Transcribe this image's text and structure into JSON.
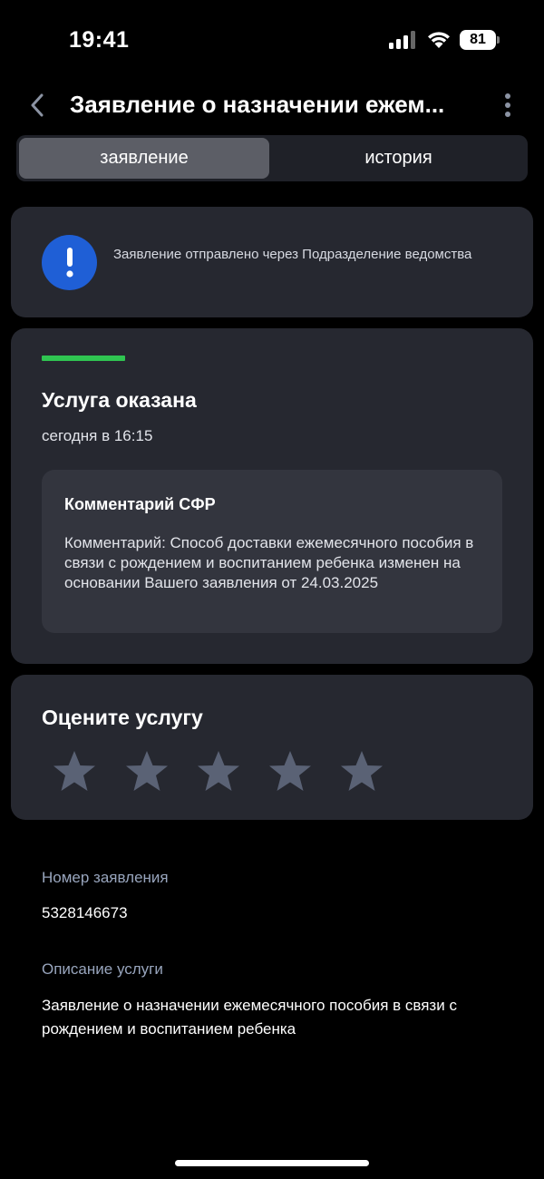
{
  "status_bar": {
    "time": "19:41",
    "battery_level": "81",
    "icons": [
      "signal-icon",
      "wifi-icon",
      "battery-icon"
    ]
  },
  "header": {
    "title": "Заявление о назначении ежем...",
    "back_icon": "chevron-left-icon",
    "menu_icon": "more-vertical-icon"
  },
  "tabs": [
    {
      "label": "заявление",
      "active": true
    },
    {
      "label": "история",
      "active": false
    }
  ],
  "notice": {
    "icon": "exclamation-icon",
    "text": "Заявление отправлено через Подразделение ведомства"
  },
  "status": {
    "title": "Услуга оказана",
    "time": "сегодня в 16:15",
    "comment_title": "Комментарий СФР",
    "comment_text": "Комментарий: Способ доставки ежемесячного пособия в связи с рождением и воспитанием ребенка изменен на основании Вашего заявления от 24.03.2025"
  },
  "rating": {
    "title": "Оцените услугу",
    "max": 5,
    "value": 0
  },
  "info": {
    "number_label": "Номер заявления",
    "number_value": "5328146673",
    "description_label": "Описание услуги",
    "description_value": "Заявление о назначении ежемесячного пособия в связи с рождением и воспитанием ребенка"
  },
  "colors": {
    "background": "#000000",
    "card": "#262830",
    "accent_blue": "#1f5fd6",
    "success_green": "#2fc551",
    "star": "#5a6275",
    "label": "#98a5bd"
  }
}
